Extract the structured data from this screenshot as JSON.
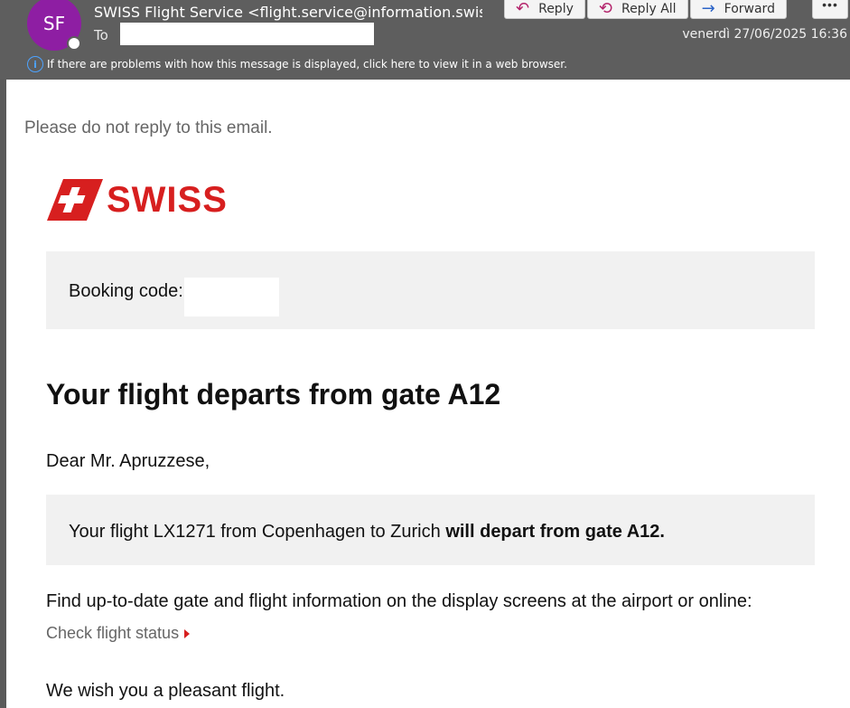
{
  "header": {
    "avatar_initials": "SF",
    "sender": "SWISS Flight Service <flight.service@information.swiss",
    "to_label": "To",
    "date": "venerdì 27/06/2025 16:36",
    "info_text": "If there are problems with how this message is displayed, click here to view it in a web browser.",
    "actions": {
      "reply": "Reply",
      "reply_all": "Reply All",
      "forward": "Forward",
      "more": "•••"
    }
  },
  "email": {
    "noreply": "Please do not reply to this email.",
    "logo_text": "SWISS",
    "booking_label": "Booking code:",
    "headline": "Your flight departs from gate A12",
    "salutation": "Dear Mr. Apruzzese,",
    "flight_text_normal": "Your flight LX1271 from Copenhagen to Zurich ",
    "flight_text_bold": "will depart from gate A12.",
    "find_text": "Find up-to-date gate and flight information on the display screens at the airport or online:",
    "check_link": "Check flight status",
    "wish": "We wish you a pleasant flight."
  },
  "colors": {
    "brand_red": "#d71f1f",
    "avatar_purple": "#8e1ea3",
    "header_bg": "#5e5e5e"
  }
}
